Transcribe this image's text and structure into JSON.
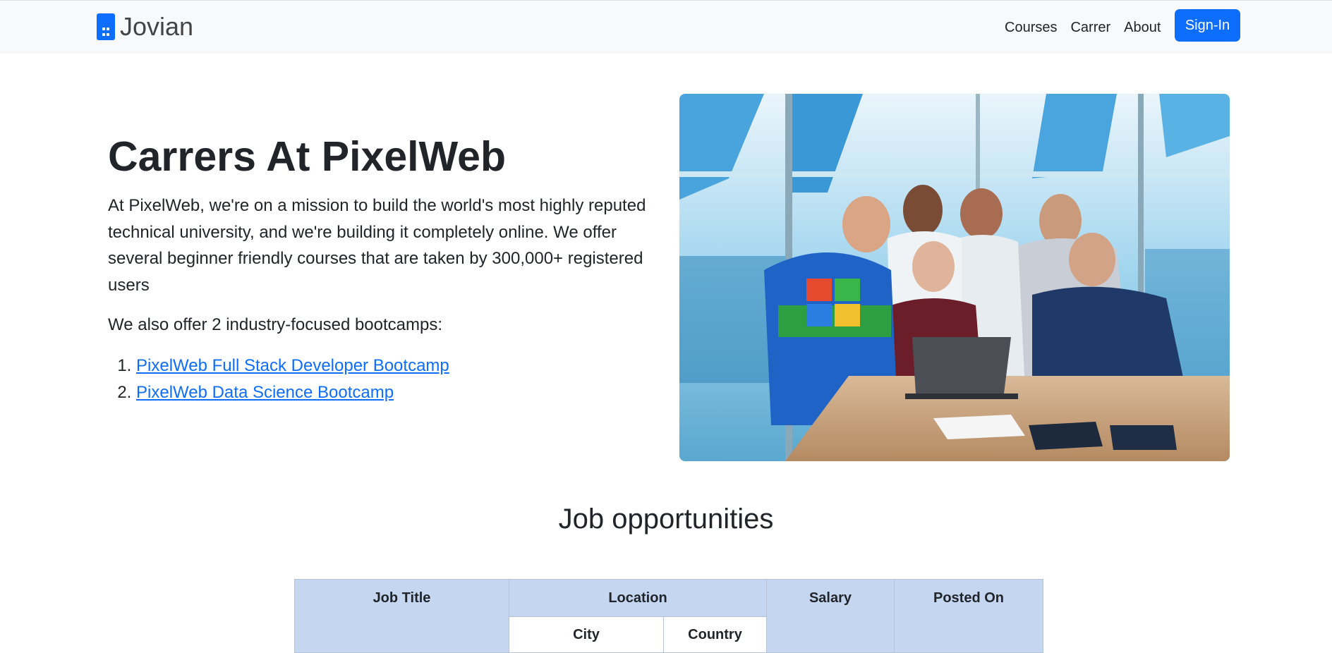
{
  "nav": {
    "brand": "Jovian",
    "links": [
      "Courses",
      "Carrer",
      "About"
    ],
    "signin_label": "Sign-In"
  },
  "hero": {
    "title": "Carrers At PixelWeb",
    "intro": "At PixelWeb, we're on a mission to build the world's most highly reputed technical university, and we're building it completely online. We offer several beginner friendly courses that are taken by 300,000+ registered users",
    "offer": "We also offer 2 industry-focused bootcamps:",
    "bootcamps": [
      "PixelWeb Full Stack Developer Bootcamp",
      "PixelWeb Data Science Bootcamp"
    ]
  },
  "jobs": {
    "title": "Job opportunities",
    "headers": {
      "job_title": "Job Title",
      "location": "Location",
      "city": "City",
      "country": "Country",
      "salary": "Salary",
      "posted_on": "Posted On"
    }
  },
  "colors": {
    "primary": "#0d6efd",
    "table_header": "#c5d6f1",
    "navbar_bg": "#f8f9fa"
  }
}
